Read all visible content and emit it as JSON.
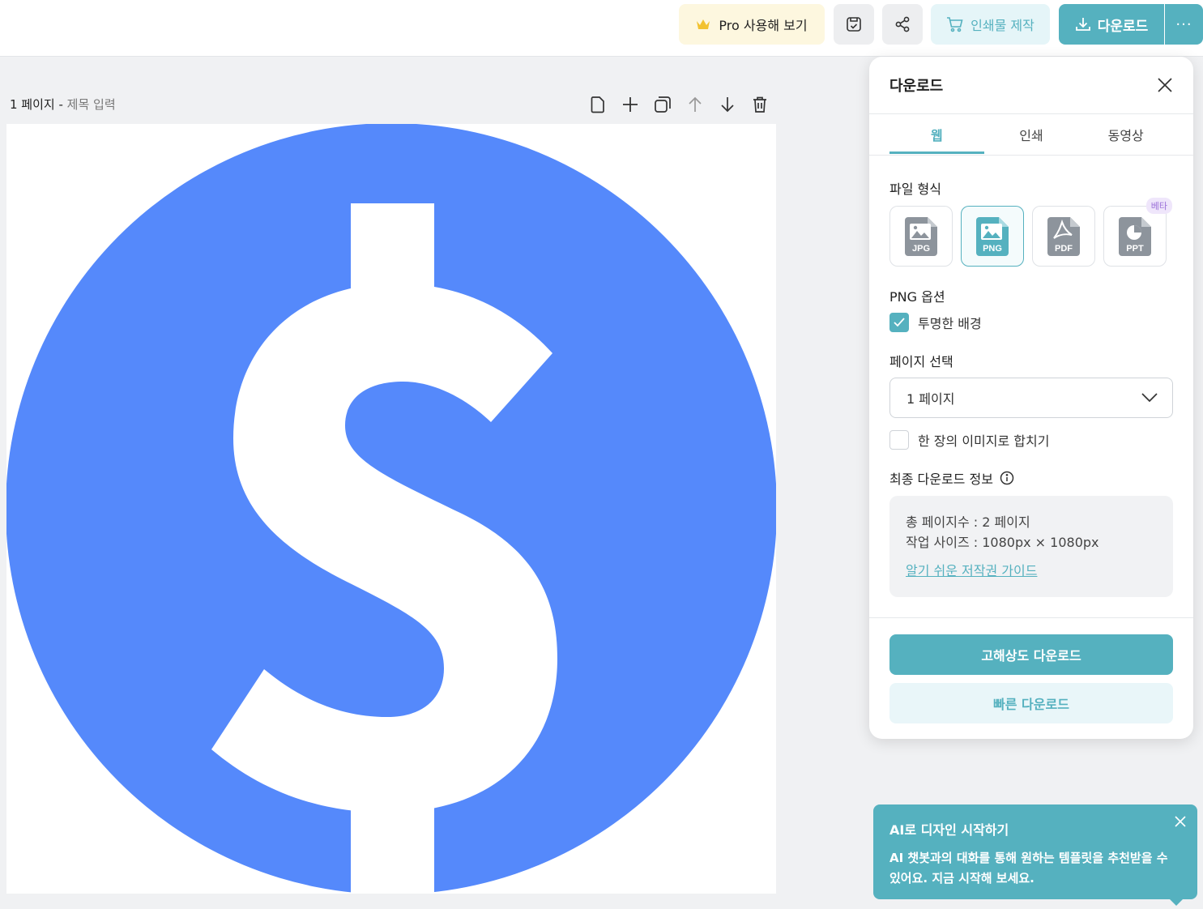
{
  "topbar": {
    "pro_label": "Pro 사용해 보기",
    "print_label": "인쇄물 제작",
    "download_label": "다운로드",
    "more_label": "···"
  },
  "page": {
    "number_label": "1 페이지",
    "separator": " - ",
    "title_placeholder": "제목 입력"
  },
  "panel": {
    "title": "다운로드",
    "tabs": [
      {
        "label": "웹"
      },
      {
        "label": "인쇄"
      },
      {
        "label": "동영상"
      }
    ],
    "file_format_label": "파일 형식",
    "formats": [
      {
        "label": "JPG"
      },
      {
        "label": "PNG"
      },
      {
        "label": "PDF"
      },
      {
        "label": "PPT"
      }
    ],
    "beta_badge": "베타",
    "png_options_label": "PNG 옵션",
    "transparent_bg_label": "투명한 배경",
    "page_select_label": "페이지 선택",
    "page_select_value": "1 페이지",
    "merge_label": "한 장의 이미지로 합치기",
    "final_info_label": "최종 다운로드 정보",
    "info": {
      "total_pages": "총 페이지수 : 2 페이지",
      "work_size": "작업 사이즈 : 1080px × 1080px",
      "guide_link": "알기 쉬운 저작권 가이드"
    },
    "hires_button": "고해상도 다운로드",
    "quick_button": "빠른 다운로드"
  },
  "toast": {
    "title": "AI로 디자인 시작하기",
    "body": "AI 챗봇과의 대화를 통해 원하는 템플릿을 추천받을 수 있어요. 지금 시작해 보세요."
  },
  "colors": {
    "accent": "#55b1bf",
    "dollar_circle": "#5589fb",
    "pro_bg": "#fdf7df"
  }
}
